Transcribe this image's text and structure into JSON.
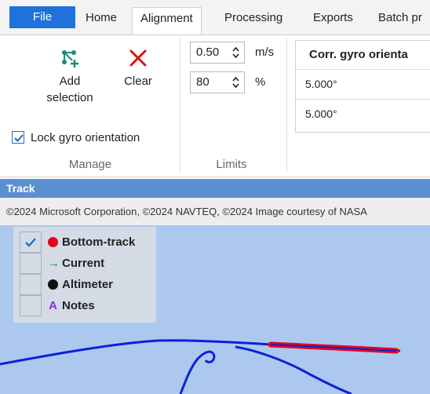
{
  "ribbon_tabs": {
    "file": "File",
    "home": "Home",
    "alignment": "Alignment",
    "processing": "Processing",
    "exports": "Exports",
    "batch": "Batch pr"
  },
  "manage_group": {
    "add_selection_line1": "Add",
    "add_selection_line2": "selection",
    "clear": "Clear",
    "lock_gyro": "Lock gyro orientation",
    "lock_gyro_checked": true,
    "label": "Manage"
  },
  "limits_group": {
    "speed_value": "0.50",
    "speed_unit": "m/s",
    "percent_value": "80",
    "percent_unit": "%",
    "label": "Limits"
  },
  "gyro_table": {
    "header": "Corr. gyro orienta",
    "rows": [
      "5.000°",
      "5.000°"
    ]
  },
  "track_panel": {
    "title": "Track",
    "copyright": "©2024 Microsoft Corporation, ©2024 NAVTEQ, ©2024 Image courtesy of NASA",
    "legend": [
      {
        "label": "Bottom-track",
        "checked": true,
        "symbol": "red-dot"
      },
      {
        "label": "Current",
        "checked": false,
        "symbol": "green-arrow"
      },
      {
        "label": "Altimeter",
        "checked": false,
        "symbol": "black-dot"
      },
      {
        "label": "Notes",
        "checked": false,
        "symbol": "purple-A"
      }
    ],
    "legend_symbols": {
      "current": "→",
      "notes": "A"
    }
  },
  "colors": {
    "file_tab": "#1e72d9",
    "track_header": "#5b8fd0",
    "map_water": "#acc8ef",
    "track_line": "#0b22d6",
    "bottom_track": "#e8001c",
    "clear_icon": "#e01010",
    "current_arrow": "#1a9a3a",
    "notes_letter": "#8a2be2"
  }
}
